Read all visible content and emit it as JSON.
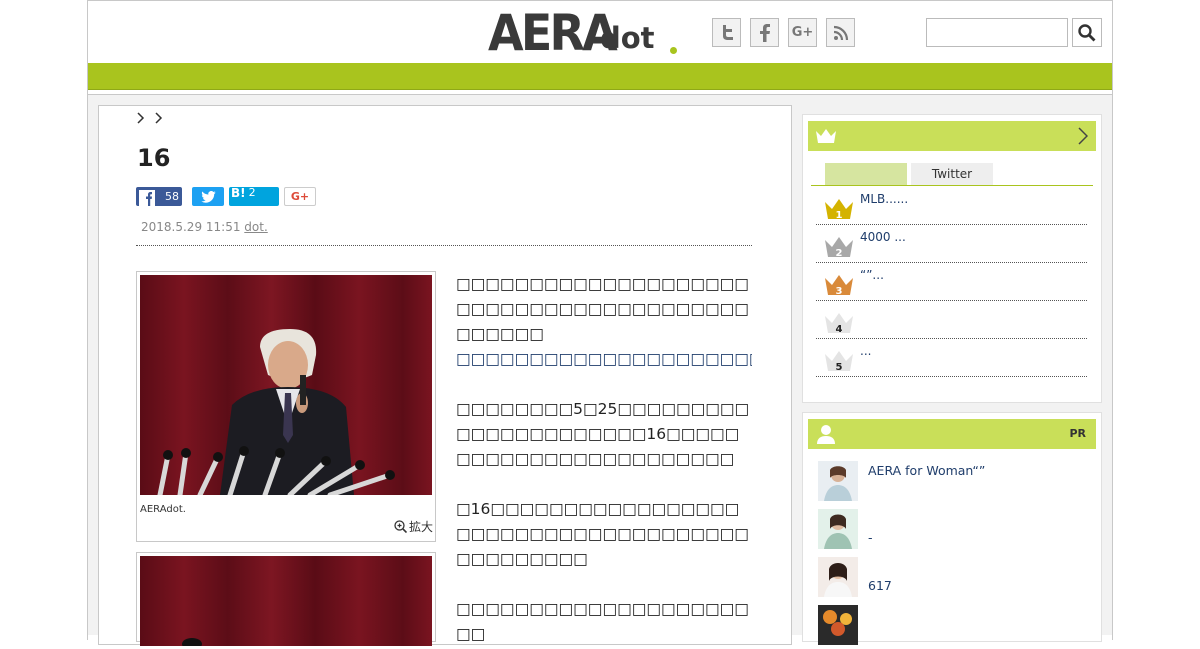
{
  "header": {
    "logo_main": "AERA",
    "logo_sub": "dot",
    "social": [
      {
        "icon": "twitter-icon",
        "glyph": "t"
      },
      {
        "icon": "facebook-icon",
        "glyph": "f"
      },
      {
        "icon": "google-plus-icon",
        "glyph": "G+"
      },
      {
        "icon": "rss-icon",
        "glyph": "rss"
      }
    ],
    "search": {
      "placeholder": ""
    }
  },
  "article": {
    "title": "16",
    "share": {
      "facebook_count": "58",
      "hatena_label": "B!",
      "hatena_count": "2",
      "gplus_label": "G+"
    },
    "date": "2018.5.29 11:51",
    "source": "dot.",
    "photo_caption": "AERAdot.",
    "enlarge_label": "拡大",
    "paragraphs": [
      "□□□□□□□□□□□□□□□□□□□□□□□□□□□□□□□□□□□□□□□□□□□□□□",
      "□□□□□□□□□□□□□□□□□□□□□□□",
      "□□□□□□□□5□25□□□□□□□□□□□□□□□□□□□□□□16□□□□□□□□□□□□□□□□□□□□□□□□",
      "□16□□□□□□□□□□□□□□□□□□□□□□□□□□□□□□□□□□□□□□□□□□□□□□",
      "□□□□□□□□□□□□□□□□□□□□□□"
    ]
  },
  "sidebar": {
    "ranking": {
      "tabs": [
        "",
        "Twitter"
      ],
      "items": [
        {
          "rank": "1",
          "text": "MLB......"
        },
        {
          "rank": "2",
          "text": "4000 ..."
        },
        {
          "rank": "3",
          "text": "“”..."
        },
        {
          "rank": "4",
          "text": ""
        },
        {
          "rank": "5",
          "text": "..."
        }
      ],
      "colors": {
        "gold": "#d4b300",
        "silver": "#a8a8a8",
        "bronze": "#d98a3a",
        "plain": "#cfcfcf"
      }
    },
    "pr": {
      "label": "PR",
      "items": [
        {
          "text": "AERA for Woman“”"
        },
        {
          "text": "-"
        },
        {
          "text": "617"
        },
        {
          "text": ""
        }
      ]
    }
  },
  "colors": {
    "accent": "#a9c41e",
    "sidebar_head": "#c9df59",
    "link": "#1f3d6b"
  }
}
